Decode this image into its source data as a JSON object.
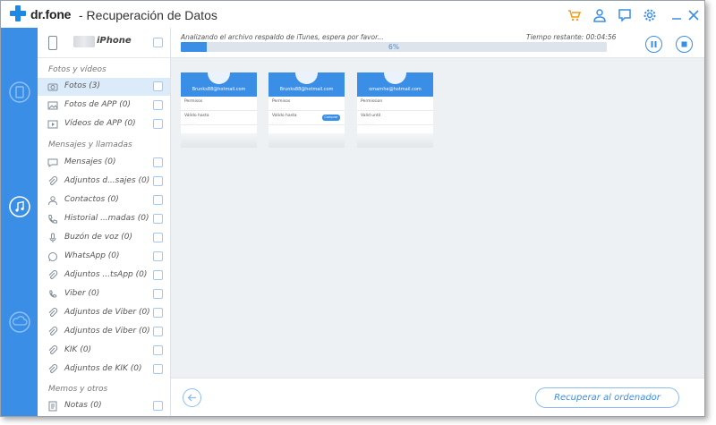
{
  "app": {
    "brand": "dr.fone",
    "title": "- Recuperación de Datos"
  },
  "device": {
    "name": "iPhone"
  },
  "sections": {
    "photos": "Fotos y vídeos",
    "messages": "Mensajes y llamadas",
    "memos": "Memos y otros"
  },
  "categories": [
    {
      "label": "Fotos (3)",
      "icon": "camera-icon"
    },
    {
      "label": "Fotos de APP (0)",
      "icon": "image-icon"
    },
    {
      "label": "Vídeos de APP (0)",
      "icon": "video-icon"
    },
    {
      "label": "Mensajes (0)",
      "icon": "message-icon"
    },
    {
      "label": "Adjuntos d...sajes (0)",
      "icon": "paperclip-icon"
    },
    {
      "label": "Contactos (0)",
      "icon": "contact-icon"
    },
    {
      "label": "Historial ...madas (0)",
      "icon": "phone-icon"
    },
    {
      "label": "Buzón de voz (0)",
      "icon": "microphone-icon"
    },
    {
      "label": "WhatsApp (0)",
      "icon": "whatsapp-icon"
    },
    {
      "label": "Adjuntos ...tsApp (0)",
      "icon": "paperclip-icon"
    },
    {
      "label": "Viber (0)",
      "icon": "viber-icon"
    },
    {
      "label": "Adjuntos de Viber (0)",
      "icon": "paperclip-icon"
    },
    {
      "label": "Adjuntos de Viber (0)",
      "icon": "paperclip-icon"
    },
    {
      "label": "KIK (0)",
      "icon": "kik-icon"
    },
    {
      "label": "Adjuntos de KIK (0)",
      "icon": "paperclip-icon"
    },
    {
      "label": "Notas (0)",
      "icon": "note-icon"
    }
  ],
  "scan": {
    "status": "Analizando el archivo respaldo de iTunes, espera por favor...",
    "time_remaining": "Tiempo restante: 00:04:56",
    "progress_label": "6%",
    "progress": 0.06
  },
  "thumbnails": [
    {
      "email": "Brunks88@hotmail.com",
      "row1": "Permisos",
      "row2": "Válido hasta",
      "button": ""
    },
    {
      "email": "Brunks88@hotmail.com",
      "row1": "Permisos",
      "row2": "Válido hasta",
      "button": "Comprar"
    },
    {
      "email": "omarnhe@hotmail.com",
      "row1": "Permission",
      "row2": "Valid until",
      "button": ""
    }
  ],
  "actions": {
    "recover": "Recuperar al ordenador"
  },
  "colors": {
    "accent": "#3a8ee6",
    "rail": "#3a8ee6",
    "cart": "#f39c12"
  }
}
